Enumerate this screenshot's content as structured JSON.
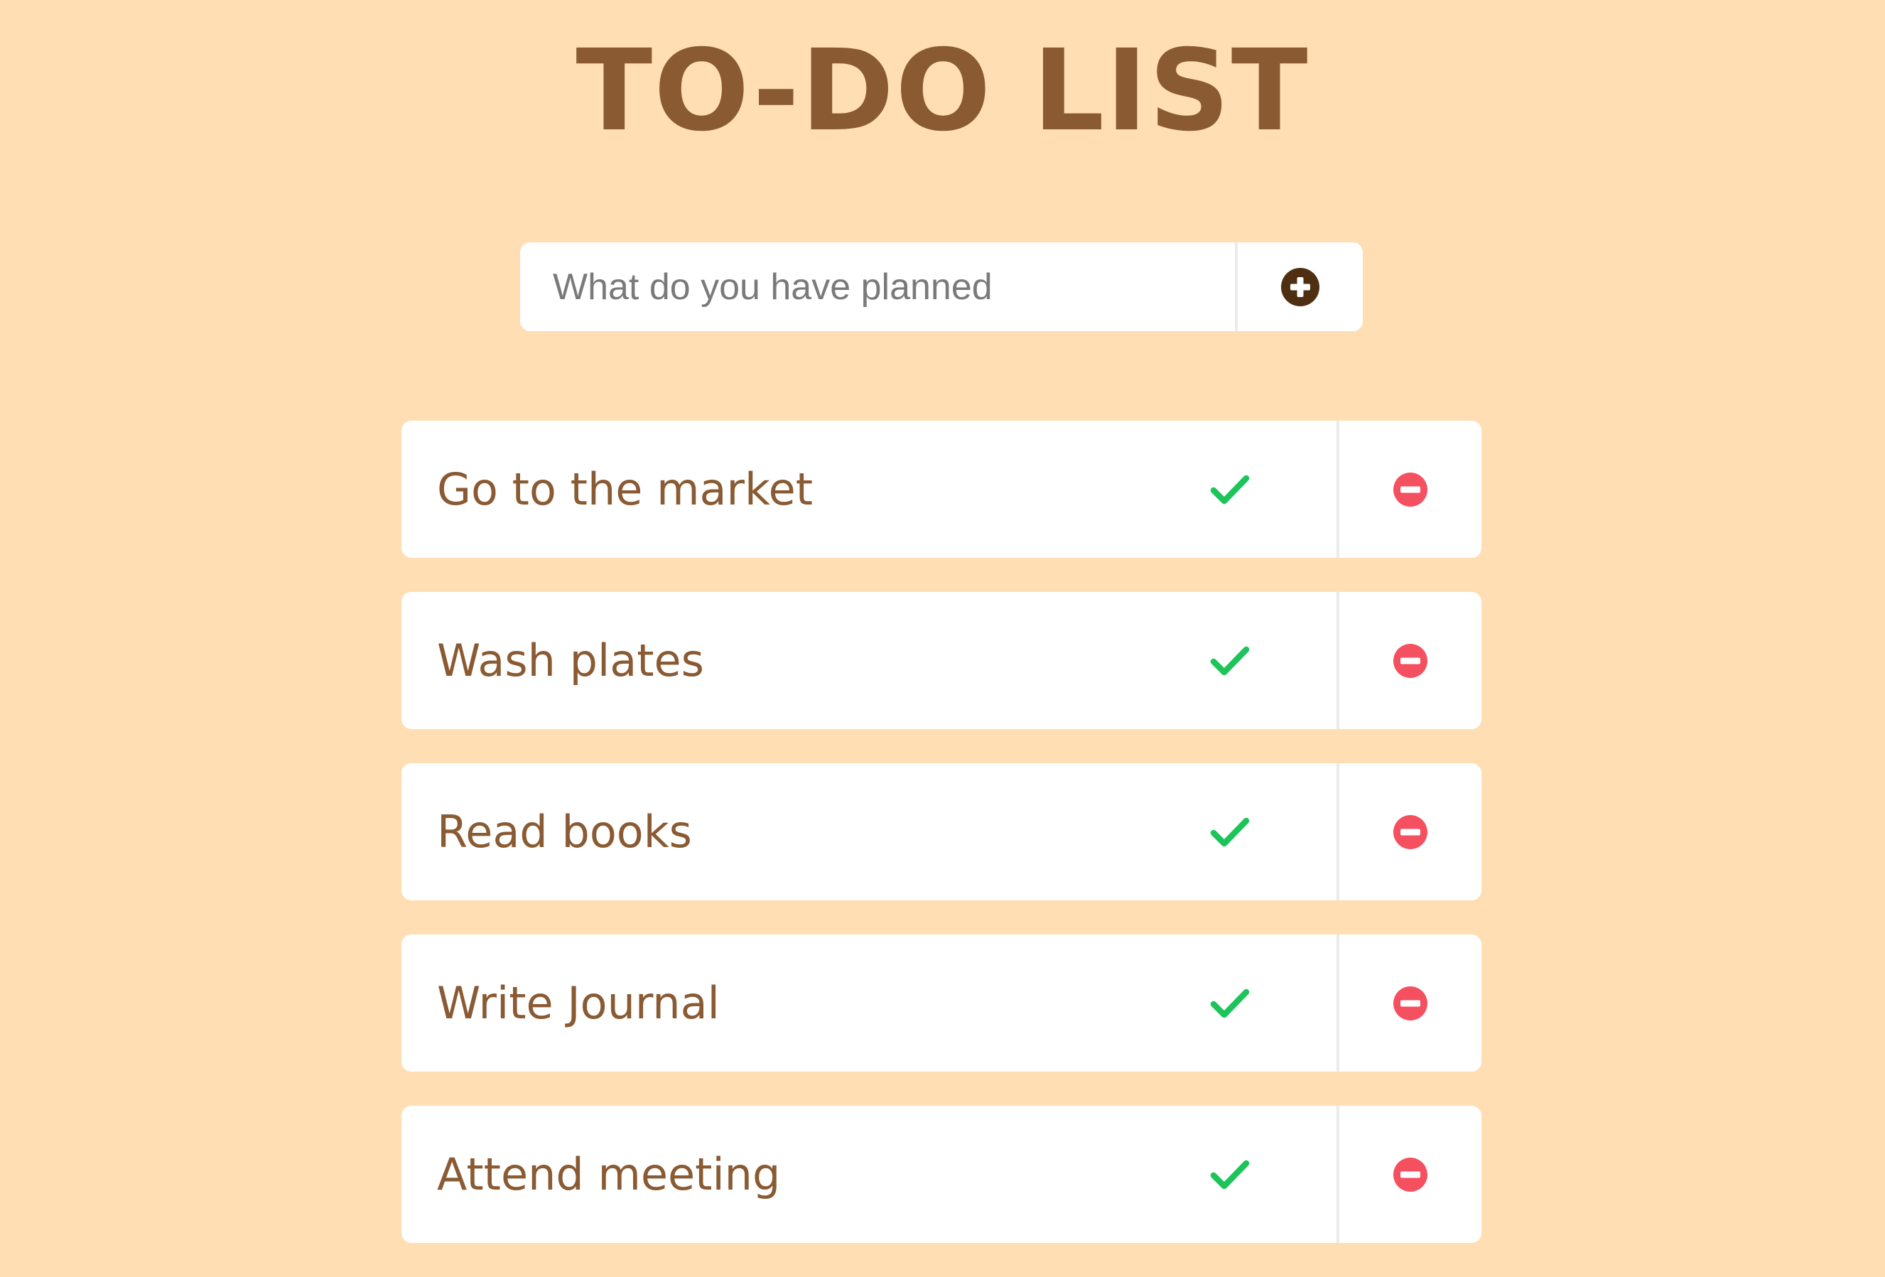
{
  "header": {
    "title": "TO-DO LIST"
  },
  "add_form": {
    "placeholder": "What do you have planned",
    "value": "",
    "add_icon": "plus-circle-icon"
  },
  "todos": [
    {
      "text": "Go to the market",
      "complete_icon": "check-icon",
      "remove_icon": "minus-circle-icon"
    },
    {
      "text": "Wash plates",
      "complete_icon": "check-icon",
      "remove_icon": "minus-circle-icon"
    },
    {
      "text": "Read books",
      "complete_icon": "check-icon",
      "remove_icon": "minus-circle-icon"
    },
    {
      "text": "Write Journal",
      "complete_icon": "check-icon",
      "remove_icon": "minus-circle-icon"
    },
    {
      "text": "Attend meeting",
      "complete_icon": "check-icon",
      "remove_icon": "minus-circle-icon"
    }
  ],
  "colors": {
    "background": "#FFDEB4",
    "text_brown": "#8A5A33",
    "add_icon": "#4E2F12",
    "check_green": "#1DC45A",
    "remove_red": "#F5505F"
  }
}
